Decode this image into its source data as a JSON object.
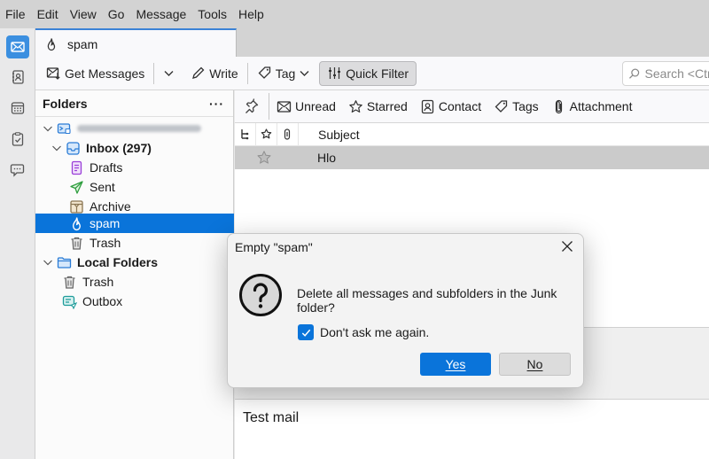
{
  "menubar": {
    "items": [
      "File",
      "Edit",
      "View",
      "Go",
      "Message",
      "Tools",
      "Help"
    ]
  },
  "spaces": {
    "items": [
      {
        "name": "mail",
        "icon": "envelope-icon",
        "active": true
      },
      {
        "name": "address-book",
        "icon": "address-book-icon",
        "active": false
      },
      {
        "name": "calendar",
        "icon": "calendar-icon",
        "active": false
      },
      {
        "name": "tasks",
        "icon": "clipboard-check-icon",
        "active": false
      },
      {
        "name": "chat",
        "icon": "chat-bubbles-icon",
        "active": false
      }
    ]
  },
  "tab": {
    "label": "spam",
    "icon": "spam-flame-icon"
  },
  "toolbar": {
    "get_messages": "Get Messages",
    "write": "Write",
    "tag": "Tag",
    "quick_filter": "Quick Filter",
    "search_placeholder": "Search <Ctrl+"
  },
  "folder_pane": {
    "title": "Folders",
    "more": "···",
    "account_name": "(blurred email address)",
    "folders": [
      {
        "label": "Inbox (297)",
        "icon": "inbox-icon",
        "bold": true
      },
      {
        "label": "Drafts",
        "icon": "drafts-icon"
      },
      {
        "label": "Sent",
        "icon": "sent-icon"
      },
      {
        "label": "Archive",
        "icon": "archive-icon"
      },
      {
        "label": "spam",
        "icon": "spam-flame-icon",
        "selected": true
      },
      {
        "label": "Trash",
        "icon": "trash-icon"
      }
    ],
    "local": {
      "label": "Local Folders",
      "folders": [
        {
          "label": "Trash",
          "icon": "trash-icon"
        },
        {
          "label": "Outbox",
          "icon": "outbox-icon"
        }
      ]
    }
  },
  "quick_filter_bar": {
    "buttons": [
      "Unread",
      "Starred",
      "Contact",
      "Tags",
      "Attachment"
    ]
  },
  "thread_pane": {
    "columns": {
      "subject": "Subject"
    },
    "rows": [
      {
        "subject": "Hlo",
        "starred": false,
        "selected": true
      }
    ]
  },
  "preview": {
    "body": "Test mail"
  },
  "dialog": {
    "title": "Empty \"spam\"",
    "message": "Delete all messages and subfolders in the Junk folder?",
    "checkbox_label": "Don't ask me again.",
    "checkbox_checked": true,
    "yes": "Yes",
    "no": "No"
  },
  "colors": {
    "accent": "#0a74da",
    "selected_row": "#cbcbcb",
    "menubar_bg": "#d3d3d3"
  }
}
